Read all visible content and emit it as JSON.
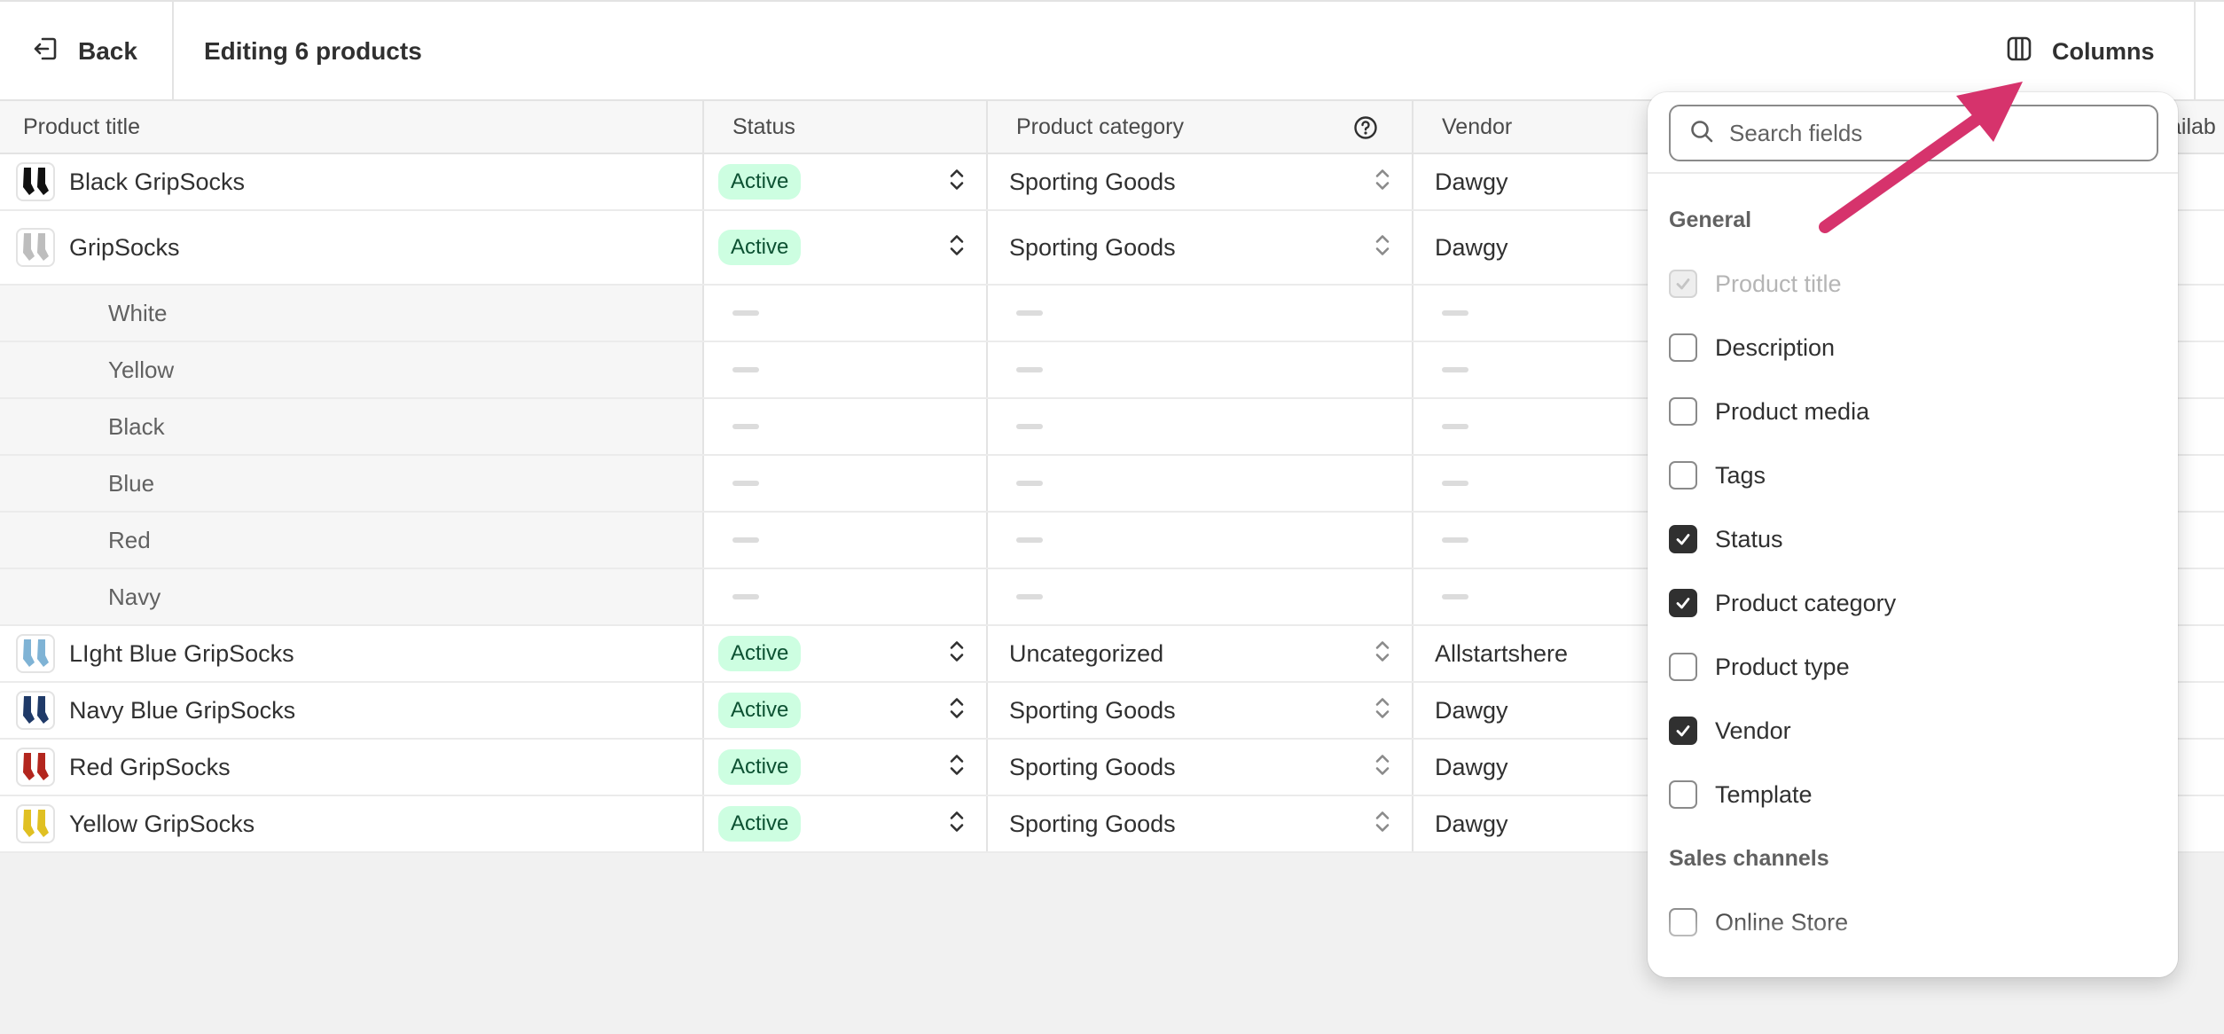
{
  "header": {
    "back_label": "Back",
    "title": "Editing 6 products",
    "columns_label": "Columns"
  },
  "table": {
    "columns": [
      "Product title",
      "Status",
      "Product category",
      "Vendor",
      "ailab"
    ],
    "rows": [
      {
        "kind": "product",
        "title": "Black GripSocks",
        "status": "Active",
        "category": "Sporting Goods",
        "vendor": "Dawgy",
        "color": "#111111"
      },
      {
        "kind": "product",
        "title": "GripSocks",
        "status": "Active",
        "category": "Sporting Goods",
        "vendor": "Dawgy",
        "color": "#bdbdbd"
      },
      {
        "kind": "variant",
        "title": "White"
      },
      {
        "kind": "variant",
        "title": "Yellow"
      },
      {
        "kind": "variant",
        "title": "Black"
      },
      {
        "kind": "variant",
        "title": "Blue"
      },
      {
        "kind": "variant",
        "title": "Red"
      },
      {
        "kind": "variant",
        "title": "Navy"
      },
      {
        "kind": "product",
        "title": "LIght Blue GripSocks",
        "status": "Active",
        "category": "Uncategorized",
        "vendor": "Allstartshere",
        "color": "#7fb3d5"
      },
      {
        "kind": "product",
        "title": "Navy Blue GripSocks",
        "status": "Active",
        "category": "Sporting Goods",
        "vendor": "Dawgy",
        "color": "#1f3a68"
      },
      {
        "kind": "product",
        "title": "Red GripSocks",
        "status": "Active",
        "category": "Sporting Goods",
        "vendor": "Dawgy",
        "color": "#b3261e"
      },
      {
        "kind": "product",
        "title": "Yellow GripSocks",
        "status": "Active",
        "category": "Sporting Goods",
        "vendor": "Dawgy",
        "color": "#e0c022"
      }
    ]
  },
  "columns_popover": {
    "search_placeholder": "Search fields",
    "section_general": "General",
    "section_sales": "Sales channels",
    "fields": [
      {
        "label": "Product title",
        "checked": true,
        "disabled": true
      },
      {
        "label": "Description",
        "checked": false
      },
      {
        "label": "Product media",
        "checked": false
      },
      {
        "label": "Tags",
        "checked": false
      },
      {
        "label": "Status",
        "checked": true
      },
      {
        "label": "Product category",
        "checked": true
      },
      {
        "label": "Product type",
        "checked": false
      },
      {
        "label": "Vendor",
        "checked": true
      },
      {
        "label": "Template",
        "checked": false
      }
    ],
    "sales_fields": [
      {
        "label": "Online Store",
        "checked": false
      }
    ]
  },
  "colors": {
    "badge_bg": "#cdfee1",
    "badge_text": "#0c5132",
    "arrow": "#d6336c"
  }
}
